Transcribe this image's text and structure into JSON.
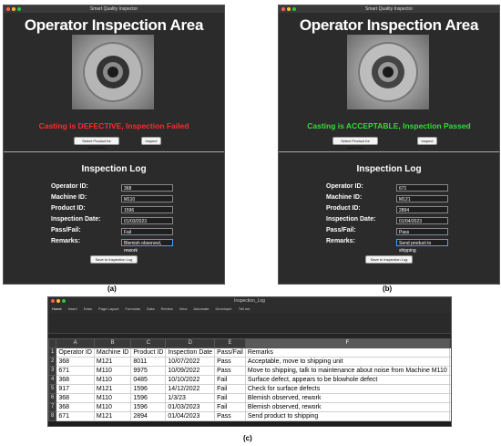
{
  "panels": [
    {
      "window_title": "Smart Quality Inspector",
      "title": "Operator Inspection Area",
      "status": "Casting is DEFECTIVE, Inspection Failed",
      "status_color": "#ff2a2a",
      "select_button": "Select Product for Inspection",
      "inspect_button": "Inspect",
      "log_title": "Inspection Log",
      "labels": [
        "Operator ID:",
        "Machine ID:",
        "Product ID:",
        "Inspection Date:",
        "Pass/Fail:",
        "Remarks:"
      ],
      "values": [
        "368",
        "M110",
        "1596",
        "01/03/2023",
        "Fail",
        "Blemish observed, rework"
      ],
      "save_button": "Save to Inspection Log",
      "caption": "(a)"
    },
    {
      "window_title": "Smart Quality Inspector",
      "title": "Operator Inspection Area",
      "status": "Casting is ACCEPTABLE, Inspection Passed",
      "status_color": "#33dd33",
      "select_button": "Select Product for Inspection",
      "inspect_button": "Inspect",
      "log_title": "Inspection Log",
      "labels": [
        "Operator ID:",
        "Machine ID:",
        "Product ID:",
        "Inspection Date:",
        "Pass/Fail:",
        "Remarks:"
      ],
      "values": [
        "671",
        "M121",
        "2894",
        "01/04/2023",
        "Pass",
        "Send product to shipping"
      ],
      "save_button": "Save to Inspection Log",
      "caption": "(b)"
    }
  ],
  "excel": {
    "window_title": "Inspection_Log",
    "tabs": [
      "Home",
      "Insert",
      "Draw",
      "Page Layout",
      "Formulas",
      "Data",
      "Review",
      "View",
      "Automate",
      "Developer",
      "Tell me"
    ],
    "col_headers": [
      "",
      "A",
      "B",
      "C",
      "D",
      "E",
      "F",
      "G"
    ],
    "rows": [
      [
        "1",
        "Operator ID",
        "Machine ID",
        "Product ID",
        "Inspection Date",
        "Pass/Fail",
        "Remarks",
        ""
      ],
      [
        "2",
        "368",
        "M121",
        "8011",
        "10/07/2022",
        "Pass",
        "Acceptable, move to shipping unit",
        ""
      ],
      [
        "3",
        "671",
        "M110",
        "9975",
        "10/09/2022",
        "Pass",
        "Move to shipping, talk to maintenance about noise from Machine M110",
        ""
      ],
      [
        "4",
        "368",
        "M110",
        "0485",
        "10/10/2022",
        "Fail",
        "Surface defect,  appears to be blowhole defect",
        ""
      ],
      [
        "5",
        "917",
        "M121",
        "1596",
        "14/12/2022",
        "Fail",
        "Check for surface defects",
        ""
      ],
      [
        "6",
        "368",
        "M110",
        "1596",
        "1/3/23",
        "Fail",
        "Blemish observed, rework",
        ""
      ],
      [
        "7",
        "368",
        "M110",
        "1596",
        "01/03/2023",
        "Fail",
        "Blemish observed, rework",
        ""
      ],
      [
        "8",
        "671",
        "M121",
        "2894",
        "01/04/2023",
        "Pass",
        "Send product to shipping",
        ""
      ]
    ],
    "caption": "(c)"
  }
}
